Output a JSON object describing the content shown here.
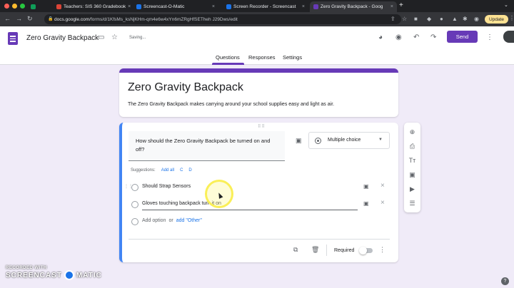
{
  "browser": {
    "tabs": [
      {
        "title": "Teachers: SIS 360 Gradebook",
        "color": "#0f9d58"
      },
      {
        "title": "Screencast-O-Matic",
        "color": "#1a73e8"
      },
      {
        "title": "Screen Recorder - Screencast",
        "color": "#1a73e8"
      },
      {
        "title": "Zero Gravity Backpack - Goog",
        "color": "#673ab7"
      }
    ],
    "url_host": "docs.google.com",
    "url_path": "/forms/d/1KfsMs_ksNjKHm-qm4e6w4xYn6mZRgHfSETheh J29Dws/edit",
    "update_label": "Update"
  },
  "header": {
    "doc_title": "Zero Gravity Backpack",
    "status": "Saving...",
    "send_label": "Send",
    "tabs": [
      "Questions",
      "Responses",
      "Settings"
    ]
  },
  "form": {
    "title": "Zero Gravity Backpack",
    "description": "The Zero Gravity Backpack makes carrying around your school supplies easy and light as air."
  },
  "question": {
    "text": "How should the Zero Gravity Backpack be turned on and off?",
    "type": "Multiple choice",
    "suggestions_label": "Suggestions:",
    "suggestions": [
      "Add all",
      "C",
      "D"
    ],
    "options": [
      "Should Strap Sensors",
      "Gloves touching backpack turn it on"
    ],
    "add_option": "Add option",
    "or": "or",
    "add_other": "add \"Other\"",
    "required_label": "Required",
    "required": false
  },
  "watermark": {
    "line1": "RECORDED WITH",
    "line2a": "SCREENCAST",
    "line2b": "MATIC"
  },
  "help": "?"
}
